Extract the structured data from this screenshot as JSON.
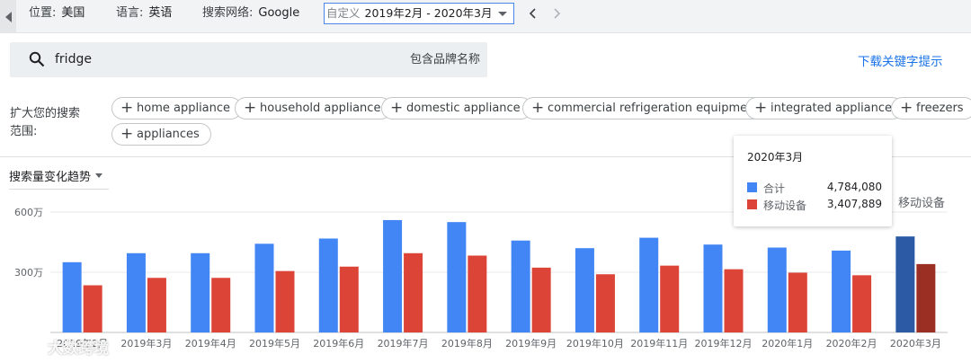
{
  "topbar": {
    "location_label": "位置:",
    "location_value": "美国",
    "language_label": "语言:",
    "language_value": "英语",
    "network_label": "搜索网络:",
    "network_value": "Google",
    "date_label": "自定义",
    "date_value": "2019年2月 - 2020年3月",
    "prev_icon": "chevron-left-icon",
    "next_icon": "chevron-right-icon"
  },
  "search": {
    "value": "fridge",
    "brand_toggle": "包含品牌名称"
  },
  "download_link": "下载关键字提示",
  "expand": {
    "label": "扩大您的搜索范围:",
    "chips": [
      "home appliance",
      "household appliance",
      "domestic appliance",
      "commercial refrigeration equipment",
      "integrated appliance",
      "freezers",
      "appliances"
    ]
  },
  "trend": {
    "title": "搜索量变化趋势",
    "legend_mobile": "移动设备"
  },
  "tooltip": {
    "title": "2020年3月",
    "rows": [
      {
        "name": "合计",
        "value": "4,784,080",
        "color": "#4285f4"
      },
      {
        "name": "移动设备",
        "value": "3,407,889",
        "color": "#db4437"
      }
    ]
  },
  "watermark": "大数跨境",
  "colors": {
    "total": "#4285f4",
    "mobile": "#db4437",
    "total_highlight": "#2c5aa5",
    "mobile_highlight": "#9c2f24"
  },
  "chart_data": {
    "type": "bar",
    "categories": [
      "2019年2月",
      "2019年3月",
      "2019年4月",
      "2019年5月",
      "2019年6月",
      "2019年7月",
      "2019年8月",
      "2019年9月",
      "2019年10月",
      "2019年11月",
      "2019年12月",
      "2020年1月",
      "2020年2月",
      "2020年3月"
    ],
    "series": [
      {
        "name": "合计",
        "values": [
          3500000,
          3950000,
          3950000,
          4420000,
          4680000,
          5600000,
          5500000,
          4580000,
          4200000,
          4720000,
          4380000,
          4230000,
          4080000,
          4784080
        ]
      },
      {
        "name": "移动设备",
        "values": [
          2350000,
          2720000,
          2720000,
          3060000,
          3280000,
          3950000,
          3830000,
          3230000,
          2900000,
          3330000,
          3150000,
          2980000,
          2850000,
          3407889
        ]
      }
    ],
    "yticks": [
      {
        "value": 3000000,
        "label": "300万"
      },
      {
        "value": 6000000,
        "label": "600万"
      }
    ],
    "ylim": [
      0,
      6600000
    ],
    "grid": true,
    "highlight_index": 13
  }
}
